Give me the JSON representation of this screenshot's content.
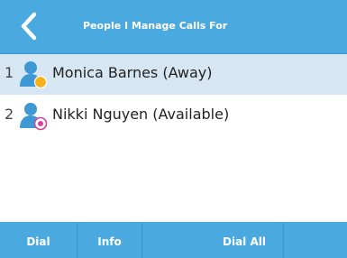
{
  "header": {
    "title": "People I Manage Calls For",
    "back_icon": "chevron-left-icon"
  },
  "list": {
    "items": [
      {
        "index": "1",
        "label": "Monica Barnes (Away)",
        "icon": "person-icon",
        "status_icon": "away-status-icon",
        "status_color": "#f5b21a",
        "selected": true
      },
      {
        "index": "2",
        "label": "Nikki Nguyen (Available)",
        "icon": "person-icon",
        "status_icon": "available-status-icon",
        "status_color": "#d6409f",
        "selected": false
      }
    ]
  },
  "softkeys": {
    "dial": "Dial",
    "info": "Info",
    "dial_all": "Dial All",
    "blank": ""
  },
  "colors": {
    "accent": "#4aa9de",
    "selected_row": "#d6e6f2",
    "avatar": "#3e98d4"
  }
}
